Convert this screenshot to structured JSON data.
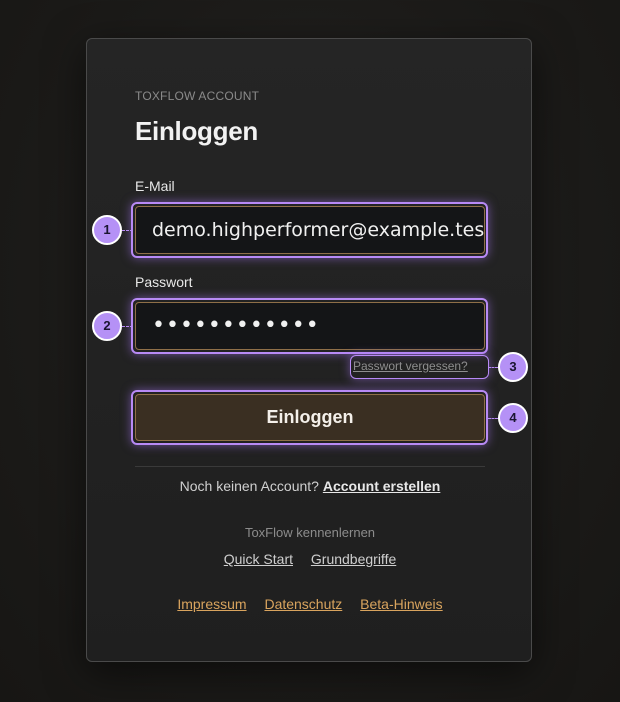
{
  "header": {
    "eyebrow": "TOXFLOW ACCOUNT",
    "title": "Einloggen"
  },
  "form": {
    "email_label": "E-Mail",
    "email_value": "demo.highperformer@example.test",
    "password_label": "Passwort",
    "password_value": "••••••••••••",
    "forgot_link": "Passwort vergessen?",
    "submit_label": "Einloggen"
  },
  "signup": {
    "prompt": "Noch keinen Account?",
    "link": "Account erstellen"
  },
  "learn": {
    "heading": "ToxFlow kennenlernen",
    "links": [
      "Quick Start",
      "Grundbegriffe"
    ]
  },
  "footer": {
    "links": [
      "Impressum",
      "Datenschutz",
      "Beta-Hinweis"
    ]
  },
  "annotations": {
    "badges": [
      "1",
      "2",
      "3",
      "4"
    ]
  },
  "colors": {
    "accent_border": "#8f6f48",
    "button_bg": "#3a2f22",
    "footer_link": "#d9a45e",
    "highlight": "#b88af6"
  }
}
